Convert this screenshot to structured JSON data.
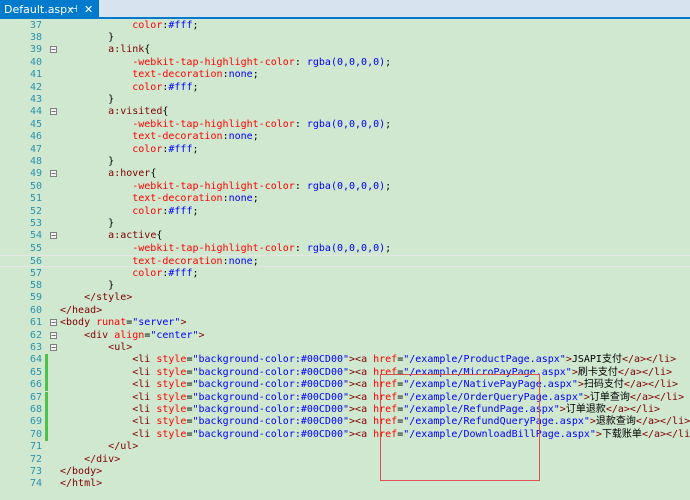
{
  "tab": {
    "title": "Default.aspx",
    "pin": "⊣",
    "close": "✕"
  },
  "lines": [
    {
      "n": "37",
      "tokens": [
        [
          "plain",
          "            "
        ],
        [
          "prop",
          "color"
        ],
        [
          "punct",
          ":"
        ],
        [
          "val",
          "#fff"
        ],
        [
          "punct",
          ";"
        ]
      ]
    },
    {
      "n": "38",
      "tokens": [
        [
          "plain",
          "        "
        ],
        [
          "punct",
          "}"
        ]
      ]
    },
    {
      "n": "39",
      "fold": "−",
      "tokens": [
        [
          "plain",
          "        "
        ],
        [
          "sel",
          "a:link"
        ],
        [
          "punct",
          "{"
        ]
      ]
    },
    {
      "n": "40",
      "tokens": [
        [
          "plain",
          "            "
        ],
        [
          "prop",
          "-webkit-tap-highlight-color"
        ],
        [
          "punct",
          ": "
        ],
        [
          "val",
          "rgba(0,0,0,0)"
        ],
        [
          "punct",
          ";"
        ]
      ]
    },
    {
      "n": "41",
      "tokens": [
        [
          "plain",
          "            "
        ],
        [
          "prop",
          "text-decoration"
        ],
        [
          "punct",
          ":"
        ],
        [
          "val",
          "none"
        ],
        [
          "punct",
          ";"
        ]
      ]
    },
    {
      "n": "42",
      "tokens": [
        [
          "plain",
          "            "
        ],
        [
          "prop",
          "color"
        ],
        [
          "punct",
          ":"
        ],
        [
          "val",
          "#fff"
        ],
        [
          "punct",
          ";"
        ]
      ]
    },
    {
      "n": "43",
      "tokens": [
        [
          "plain",
          "        "
        ],
        [
          "punct",
          "}"
        ]
      ]
    },
    {
      "n": "44",
      "fold": "−",
      "tokens": [
        [
          "plain",
          "        "
        ],
        [
          "sel",
          "a:visited"
        ],
        [
          "punct",
          "{"
        ]
      ]
    },
    {
      "n": "45",
      "tokens": [
        [
          "plain",
          "            "
        ],
        [
          "prop",
          "-webkit-tap-highlight-color"
        ],
        [
          "punct",
          ": "
        ],
        [
          "val",
          "rgba(0,0,0,0)"
        ],
        [
          "punct",
          ";"
        ]
      ]
    },
    {
      "n": "46",
      "tokens": [
        [
          "plain",
          "            "
        ],
        [
          "prop",
          "text-decoration"
        ],
        [
          "punct",
          ":"
        ],
        [
          "val",
          "none"
        ],
        [
          "punct",
          ";"
        ]
      ]
    },
    {
      "n": "47",
      "tokens": [
        [
          "plain",
          "            "
        ],
        [
          "prop",
          "color"
        ],
        [
          "punct",
          ":"
        ],
        [
          "val",
          "#fff"
        ],
        [
          "punct",
          ";"
        ]
      ]
    },
    {
      "n": "48",
      "tokens": [
        [
          "plain",
          "        "
        ],
        [
          "punct",
          "}"
        ]
      ]
    },
    {
      "n": "49",
      "fold": "−",
      "tokens": [
        [
          "plain",
          "        "
        ],
        [
          "sel",
          "a:hover"
        ],
        [
          "punct",
          "{"
        ]
      ]
    },
    {
      "n": "50",
      "tokens": [
        [
          "plain",
          "            "
        ],
        [
          "prop",
          "-webkit-tap-highlight-color"
        ],
        [
          "punct",
          ": "
        ],
        [
          "val",
          "rgba(0,0,0,0)"
        ],
        [
          "punct",
          ";"
        ]
      ]
    },
    {
      "n": "51",
      "tokens": [
        [
          "plain",
          "            "
        ],
        [
          "prop",
          "text-decoration"
        ],
        [
          "punct",
          ":"
        ],
        [
          "val",
          "none"
        ],
        [
          "punct",
          ";"
        ]
      ]
    },
    {
      "n": "52",
      "tokens": [
        [
          "plain",
          "            "
        ],
        [
          "prop",
          "color"
        ],
        [
          "punct",
          ":"
        ],
        [
          "val",
          "#fff"
        ],
        [
          "punct",
          ";"
        ]
      ]
    },
    {
      "n": "53",
      "tokens": [
        [
          "plain",
          "        "
        ],
        [
          "punct",
          "}"
        ]
      ]
    },
    {
      "n": "54",
      "fold": "−",
      "tokens": [
        [
          "plain",
          "        "
        ],
        [
          "sel",
          "a:active"
        ],
        [
          "punct",
          "{"
        ]
      ]
    },
    {
      "n": "55",
      "tokens": [
        [
          "plain",
          "            "
        ],
        [
          "prop",
          "-webkit-tap-highlight-color"
        ],
        [
          "punct",
          ": "
        ],
        [
          "val",
          "rgba(0,0,0,0)"
        ],
        [
          "punct",
          ";"
        ]
      ]
    },
    {
      "n": "56",
      "current": true,
      "tokens": [
        [
          "plain",
          "            "
        ],
        [
          "prop",
          "text-decoration"
        ],
        [
          "punct",
          ":"
        ],
        [
          "val",
          "none"
        ],
        [
          "punct",
          ";"
        ]
      ]
    },
    {
      "n": "57",
      "tokens": [
        [
          "plain",
          "            "
        ],
        [
          "prop",
          "color"
        ],
        [
          "punct",
          ":"
        ],
        [
          "val",
          "#fff"
        ],
        [
          "punct",
          ";"
        ]
      ]
    },
    {
      "n": "58",
      "tokens": [
        [
          "plain",
          "        "
        ],
        [
          "punct",
          "}"
        ]
      ]
    },
    {
      "n": "59",
      "tokens": [
        [
          "plain",
          "    "
        ],
        [
          "tag",
          "</style>"
        ]
      ]
    },
    {
      "n": "60",
      "tokens": [
        [
          "tag",
          "</head>"
        ]
      ]
    },
    {
      "n": "61",
      "fold": "−",
      "tokens": [
        [
          "tag",
          "<body "
        ],
        [
          "attr",
          "runat"
        ],
        [
          "punct",
          "="
        ],
        [
          "str",
          "\"server\""
        ],
        [
          "tag",
          ">"
        ]
      ]
    },
    {
      "n": "62",
      "fold": "−",
      "tokens": [
        [
          "plain",
          "    "
        ],
        [
          "tag",
          "<div "
        ],
        [
          "attr",
          "align"
        ],
        [
          "punct",
          "="
        ],
        [
          "str",
          "\"center\""
        ],
        [
          "tag",
          ">"
        ]
      ]
    },
    {
      "n": "63",
      "fold": "−",
      "tokens": [
        [
          "plain",
          "        "
        ],
        [
          "tag",
          "<ul>"
        ]
      ]
    },
    {
      "n": "64",
      "changed": true,
      "tokens": [
        [
          "plain",
          "            "
        ],
        [
          "tag",
          "<li "
        ],
        [
          "attr",
          "style"
        ],
        [
          "punct",
          "="
        ],
        [
          "str",
          "\"background-color:#00CD00\""
        ],
        [
          "tag",
          "><a "
        ],
        [
          "attr",
          "href"
        ],
        [
          "punct",
          "="
        ],
        [
          "str",
          "\"/example/ProductPage.aspx\""
        ],
        [
          "tag",
          ">"
        ],
        [
          "text",
          "JSAPI支付"
        ],
        [
          "tag",
          "</a></li>"
        ]
      ]
    },
    {
      "n": "65",
      "changed": true,
      "tokens": [
        [
          "plain",
          "            "
        ],
        [
          "tag",
          "<li "
        ],
        [
          "attr",
          "style"
        ],
        [
          "punct",
          "="
        ],
        [
          "str",
          "\"background-color:#00CD00\""
        ],
        [
          "tag",
          "><a "
        ],
        [
          "attr",
          "href"
        ],
        [
          "punct",
          "="
        ],
        [
          "str",
          "\"/example/MicroPayPage.aspx\""
        ],
        [
          "tag",
          ">"
        ],
        [
          "text",
          "刷卡支付"
        ],
        [
          "tag",
          "</a></li>"
        ]
      ]
    },
    {
      "n": "66",
      "changed": true,
      "tokens": [
        [
          "plain",
          "            "
        ],
        [
          "tag",
          "<li "
        ],
        [
          "attr",
          "style"
        ],
        [
          "punct",
          "="
        ],
        [
          "str",
          "\"background-color:#00CD00\""
        ],
        [
          "tag",
          "><a "
        ],
        [
          "attr",
          "href"
        ],
        [
          "punct",
          "="
        ],
        [
          "str",
          "\"/example/NativePayPage.aspx\""
        ],
        [
          "tag",
          ">"
        ],
        [
          "text",
          "扫码支付"
        ],
        [
          "tag",
          "</a></li>"
        ]
      ]
    },
    {
      "n": "67",
      "changed": true,
      "tokens": [
        [
          "plain",
          "            "
        ],
        [
          "tag",
          "<li "
        ],
        [
          "attr",
          "style"
        ],
        [
          "punct",
          "="
        ],
        [
          "str",
          "\"background-color:#00CD00\""
        ],
        [
          "tag",
          "><a "
        ],
        [
          "attr",
          "href"
        ],
        [
          "punct",
          "="
        ],
        [
          "str",
          "\"/example/OrderQueryPage.aspx\""
        ],
        [
          "tag",
          ">"
        ],
        [
          "text",
          "订单查询"
        ],
        [
          "tag",
          "</a></li>"
        ]
      ]
    },
    {
      "n": "68",
      "changed": true,
      "tokens": [
        [
          "plain",
          "            "
        ],
        [
          "tag",
          "<li "
        ],
        [
          "attr",
          "style"
        ],
        [
          "punct",
          "="
        ],
        [
          "str",
          "\"background-color:#00CD00\""
        ],
        [
          "tag",
          "><a "
        ],
        [
          "attr",
          "href"
        ],
        [
          "punct",
          "="
        ],
        [
          "str",
          "\"/example/RefundPage.aspx\""
        ],
        [
          "tag",
          ">"
        ],
        [
          "text",
          "订单退款"
        ],
        [
          "tag",
          "</a></li>"
        ]
      ]
    },
    {
      "n": "69",
      "changed": true,
      "tokens": [
        [
          "plain",
          "            "
        ],
        [
          "tag",
          "<li "
        ],
        [
          "attr",
          "style"
        ],
        [
          "punct",
          "="
        ],
        [
          "str",
          "\"background-color:#00CD00\""
        ],
        [
          "tag",
          "><a "
        ],
        [
          "attr",
          "href"
        ],
        [
          "punct",
          "="
        ],
        [
          "str",
          "\"/example/RefundQueryPage.aspx\""
        ],
        [
          "tag",
          ">"
        ],
        [
          "text",
          "退款查询"
        ],
        [
          "tag",
          "</a></li>"
        ]
      ]
    },
    {
      "n": "70",
      "changed": true,
      "tokens": [
        [
          "plain",
          "            "
        ],
        [
          "tag",
          "<li "
        ],
        [
          "attr",
          "style"
        ],
        [
          "punct",
          "="
        ],
        [
          "str",
          "\"background-color:#00CD00\""
        ],
        [
          "tag",
          "><a "
        ],
        [
          "attr",
          "href"
        ],
        [
          "punct",
          "="
        ],
        [
          "str",
          "\"/example/DownloadBillPage.aspx\""
        ],
        [
          "tag",
          ">"
        ],
        [
          "text",
          "下载账单"
        ],
        [
          "tag",
          "</a></li>"
        ]
      ]
    },
    {
      "n": "71",
      "tokens": [
        [
          "plain",
          "        "
        ],
        [
          "tag",
          "</ul>"
        ]
      ]
    },
    {
      "n": "72",
      "tokens": [
        [
          "plain",
          "    "
        ],
        [
          "tag",
          "</div>"
        ]
      ]
    },
    {
      "n": "73",
      "tokens": [
        [
          "tag",
          "</body>"
        ]
      ]
    },
    {
      "n": "74",
      "tokens": [
        [
          "tag",
          "</html>"
        ]
      ]
    }
  ],
  "colors": {
    "accent": "#007acc",
    "editor_bg": "#cfe8cf",
    "line_number": "#2b91af",
    "change_marker": "#4cc24c",
    "highlight_box": "#e05050"
  }
}
